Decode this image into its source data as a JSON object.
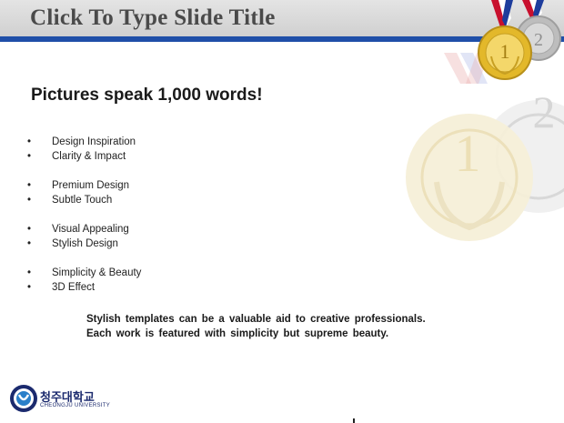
{
  "slide": {
    "title": "Click To Type Slide Title",
    "headline": "Pictures speak 1,000 words!",
    "bullets": [
      "Design Inspiration",
      "Clarity & Impact",
      "Premium Design",
      "Subtle Touch",
      "Visual Appealing",
      "Stylish Design",
      "Simplicity & Beauty",
      "3D Effect"
    ],
    "bullet_glyph": "•",
    "caption_lines": [
      "Stylish templates can be a valuable aid to creative professionals.",
      "Each work is featured with simplicity but supreme beauty."
    ]
  },
  "logo": {
    "name_ko": "청주대학교",
    "name_en": "CHEONGJU UNIVERSITY",
    "icon": "university-emblem-icon"
  },
  "decor": {
    "icons": [
      "gold-medal-icon",
      "silver-medal-icon",
      "medal-watermark-icon"
    ],
    "medal_numbers": [
      "1",
      "2"
    ]
  },
  "colors": {
    "title_bar": "#d9d9d9",
    "title_rule": "#1f4fa8",
    "title_text": "#4a4a4a",
    "gold": "#e3b82a",
    "silver": "#c0c0c0",
    "logo_blue": "#1b2a6e"
  }
}
